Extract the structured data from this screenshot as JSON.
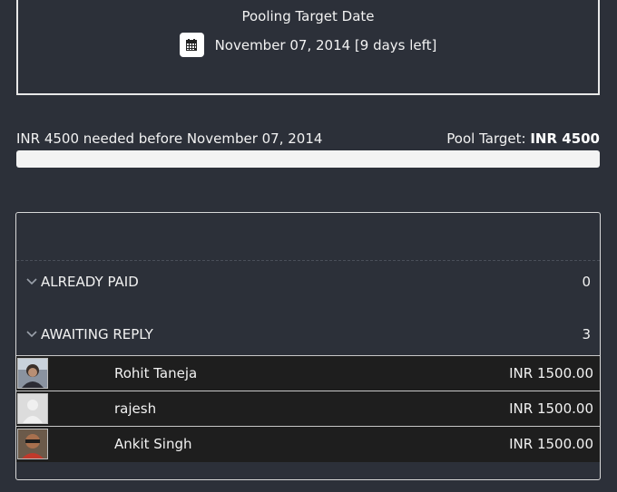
{
  "target": {
    "title": "Pooling Target Date",
    "calendar_icon": "calendar-icon",
    "date_text": "November 07, 2014 [9 days left]"
  },
  "summary": {
    "needed_text": "INR 4500 needed before November 07, 2014",
    "pool_target_label": "Pool Target:",
    "pool_target_value": "INR 4500",
    "progress_fraction": 0
  },
  "sections": {
    "paid": {
      "label": "ALREADY PAID",
      "count": "0",
      "icon": "chevron-down-icon"
    },
    "awaiting": {
      "label": "AWAITING REPLY",
      "count": "3",
      "icon": "chevron-down-icon"
    }
  },
  "members": [
    {
      "name": "Rohit Taneja",
      "amount": "INR 1500.00",
      "avatar": "user-photo"
    },
    {
      "name": "rajesh",
      "amount": "INR 1500.00",
      "avatar": "default-avatar"
    },
    {
      "name": "Ankit Singh",
      "amount": "INR 1500.00",
      "avatar": "user-photo"
    }
  ],
  "colors": {
    "background": "#2c3039",
    "row_background": "#1e1e1e",
    "progress_track": "#f3f3f3"
  }
}
